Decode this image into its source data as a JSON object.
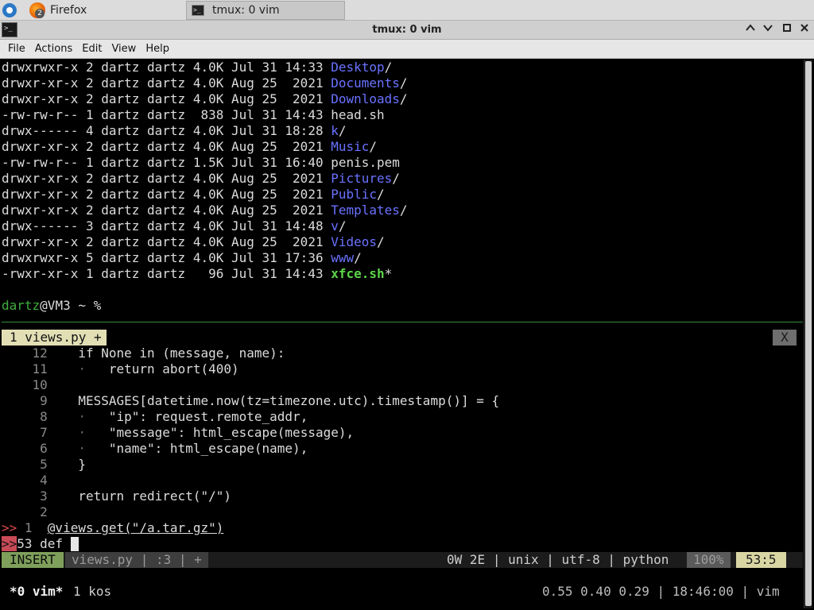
{
  "taskbar": {
    "firefox_label": "Firefox",
    "firefox_badge": "2",
    "tmux_label": "tmux: 0 vim"
  },
  "window": {
    "title": "tmux: 0 vim",
    "minimize": "^",
    "restore": "⌃",
    "maximize": "□",
    "close": "✕"
  },
  "menu": [
    "File",
    "Actions",
    "Edit",
    "View",
    "Help"
  ],
  "listing": [
    {
      "meta": "drwxrwxr-x 2 dartz dartz 4.0K Jul 31 14:33 ",
      "name": "Desktop",
      "suffix": "/",
      "type": "dir"
    },
    {
      "meta": "drwxr-xr-x 2 dartz dartz 4.0K Aug 25  2021 ",
      "name": "Documents",
      "suffix": "/",
      "type": "dir"
    },
    {
      "meta": "drwxr-xr-x 2 dartz dartz 4.0K Aug 25  2021 ",
      "name": "Downloads",
      "suffix": "/",
      "type": "dir"
    },
    {
      "meta": "-rw-rw-r-- 1 dartz dartz  838 Jul 31 14:43 ",
      "name": "head.sh",
      "suffix": "",
      "type": "file"
    },
    {
      "meta": "drwx------ 4 dartz dartz 4.0K Jul 31 18:28 ",
      "name": "k",
      "suffix": "/",
      "type": "dir"
    },
    {
      "meta": "drwxr-xr-x 2 dartz dartz 4.0K Aug 25  2021 ",
      "name": "Music",
      "suffix": "/",
      "type": "dir"
    },
    {
      "meta": "-rw-rw-r-- 1 dartz dartz 1.5K Jul 31 16:40 ",
      "name": "penis.pem",
      "suffix": "",
      "type": "file"
    },
    {
      "meta": "drwxr-xr-x 2 dartz dartz 4.0K Aug 25  2021 ",
      "name": "Pictures",
      "suffix": "/",
      "type": "dir"
    },
    {
      "meta": "drwxr-xr-x 2 dartz dartz 4.0K Aug 25  2021 ",
      "name": "Public",
      "suffix": "/",
      "type": "dir"
    },
    {
      "meta": "drwxr-xr-x 2 dartz dartz 4.0K Aug 25  2021 ",
      "name": "Templates",
      "suffix": "/",
      "type": "dir"
    },
    {
      "meta": "drwx------ 3 dartz dartz 4.0K Jul 31 14:48 ",
      "name": "v",
      "suffix": "/",
      "type": "dir"
    },
    {
      "meta": "drwxr-xr-x 2 dartz dartz 4.0K Aug 25  2021 ",
      "name": "Videos",
      "suffix": "/",
      "type": "dir"
    },
    {
      "meta": "drwxrwxr-x 5 dartz dartz 4.0K Jul 31 17:36 ",
      "name": "www",
      "suffix": "/",
      "type": "dir"
    },
    {
      "meta": "-rwxr-xr-x 1 dartz dartz   96 Jul 31 14:43 ",
      "name": "xfce.sh",
      "suffix": "*",
      "type": "exe"
    }
  ],
  "prompt": {
    "user": "dartz",
    "rest": "@VM3 ~ %"
  },
  "vim": {
    "tab_label": "1 views.py +",
    "tab_close": "X",
    "lines": [
      {
        "sign": "",
        "num": "12",
        "code": "    if None in (message, name):"
      },
      {
        "sign": "",
        "num": "11",
        "code": "    ·   return abort(400)"
      },
      {
        "sign": "",
        "num": "10",
        "code": ""
      },
      {
        "sign": "",
        "num": " 9",
        "code": "    MESSAGES[datetime.now(tz=timezone.utc).timestamp()] = {"
      },
      {
        "sign": "",
        "num": " 8",
        "code": "    ·   \"ip\": request.remote_addr,"
      },
      {
        "sign": "",
        "num": " 7",
        "code": "    ·   \"message\": html_escape(message),"
      },
      {
        "sign": "",
        "num": " 6",
        "code": "    ·   \"name\": html_escape(name),"
      },
      {
        "sign": "",
        "num": " 5",
        "code": "    }"
      },
      {
        "sign": "",
        "num": " 4",
        "code": ""
      },
      {
        "sign": "",
        "num": " 3",
        "code": "    return redirect(\"/\")"
      },
      {
        "sign": "",
        "num": " 2",
        "code": ""
      }
    ],
    "sign_line": {
      "sign": ">>",
      "num": " 1",
      "code": "@views.get(\"/a.tar.gz\")"
    },
    "current_line": {
      "sign": ">>",
      "num": "53",
      "code": " def "
    },
    "status": {
      "mode": "INSERT",
      "file": "views.py",
      "sep1": "|",
      "bufinfo": ":3",
      "sep2": "|",
      "modified": "+",
      "diag": "0W 2E",
      "format": "unix",
      "encoding": "utf-8",
      "filetype": "python",
      "percent": "100%",
      "position": "53:5",
      "pipe": "|"
    }
  },
  "tmux": {
    "window_active": "*0 vim*",
    "window_other": "1 kos",
    "load": "0.55 0.40 0.29",
    "time": "18:46:00",
    "host": "vim",
    "pipe": "|"
  }
}
